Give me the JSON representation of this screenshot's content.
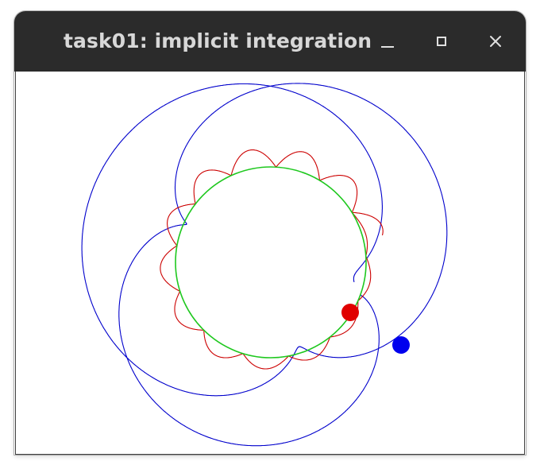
{
  "window": {
    "title": "task01: implicit integration",
    "controls": {
      "minimize_icon": "minimize-icon",
      "maximize_icon": "maximize-icon",
      "close_icon": "close-icon"
    }
  },
  "scene": {
    "colors": {
      "titlebar": "#2b2b2b",
      "title_text": "#d8d8d8",
      "constraint_circle": "#1ec81e",
      "implicit_path": "#cc0000",
      "explicit_path": "#0000cc",
      "implicit_particle": "#e00000",
      "explicit_particle": "#0000ee"
    }
  }
}
